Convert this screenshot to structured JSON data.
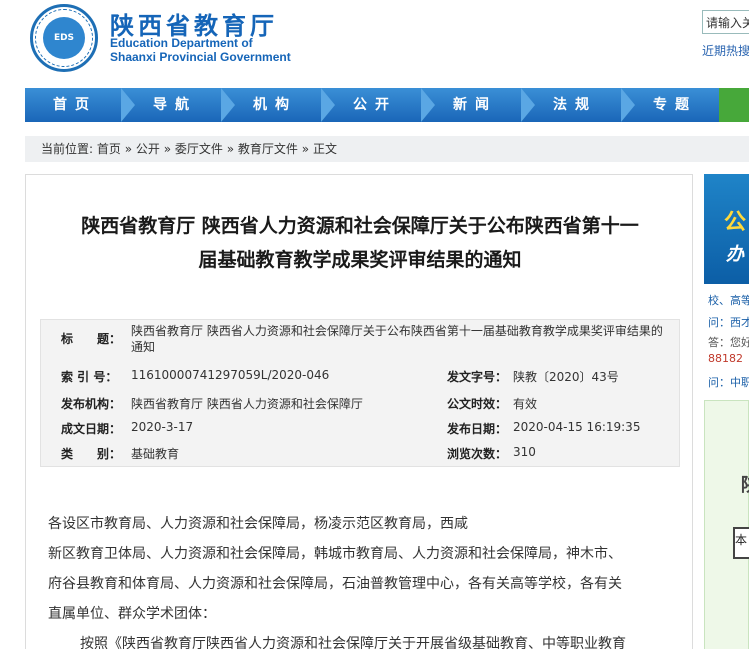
{
  "header": {
    "site_name_cn": "陕西省教育厅",
    "site_name_en_line1": "Education Department of",
    "site_name_en_line2": "Shaanxi Provincial Government",
    "logo_text": "EDS",
    "search_value": "请输入关",
    "hot_search": "近期热搜"
  },
  "nav": {
    "items": [
      {
        "label": "首页"
      },
      {
        "label": "导航"
      },
      {
        "label": "机构"
      },
      {
        "label": "公开"
      },
      {
        "label": "新闻"
      },
      {
        "label": "法规"
      },
      {
        "label": "专题"
      }
    ]
  },
  "breadcrumb": {
    "prefix": "当前位置:",
    "items": [
      "首页",
      "公开",
      "委厅文件",
      "教育厅文件",
      "正文"
    ],
    "separator": "»"
  },
  "article": {
    "title_line1": "陕西省教育厅 陕西省人力资源和社会保障厅关于公布陕西省第十一",
    "title_line2": "届基础教育教学成果奖评审结果的通知",
    "meta": {
      "title_label": "标　　题：",
      "title_value_line1": "陕西省教育厅 陕西省人力资源和社会保障厅关于公布陕西省第十一届基础教育教学成果奖评审结果的",
      "title_value_line2": "通知",
      "index_label": "索 引 号：",
      "index_value": "11610000741297059L/2020-046",
      "doc_no_label": "发文字号：",
      "doc_no_value": "陕教〔2020〕43号",
      "issuer_label": "发布机构：",
      "issuer_value": "陕西省教育厅 陕西省人力资源和社会保障厅",
      "validity_label": "公文时效：",
      "validity_value": "有效",
      "date_label": "成文日期：",
      "date_value": "2020-3-17",
      "publish_label": "发布日期：",
      "publish_value": "2020-04-15 16:19:35",
      "category_label": "类　　别：",
      "category_value": "基础教育",
      "views_label": "浏览次数：",
      "views_value": "310"
    },
    "body_line1": "各设区市教育局、人力资源和社会保障局，杨凌示范区教育局，西咸",
    "body_line2": "新区教育卫体局、人力资源和社会保障局，韩城市教育局、人力资源和社会保障局，神木市、",
    "body_line3": "府谷县教育和体育局、人力资源和社会保障局，石油普教管理中心，各有关高等学校，各有关",
    "body_line4": "直属单位、群众学术团体：",
    "body_line5": "按照《陕西省教育厅陕西省人力资源和社会保障厅关于开展省级基础教育、中等职业教育"
  },
  "sidebar": {
    "banner_text1": "公",
    "banner_text2": "办",
    "line1": "校、高等",
    "line2": "问：西才",
    "line3": "答：您好",
    "line4": "88182",
    "line5": "问：中职",
    "green_text": "陕",
    "box_text": "本"
  },
  "colors": {
    "brand_blue": "#1565b8",
    "nav_blue": "#1a66b8",
    "nav_green": "#47a83a",
    "sidebar_red": "#c0392b"
  }
}
